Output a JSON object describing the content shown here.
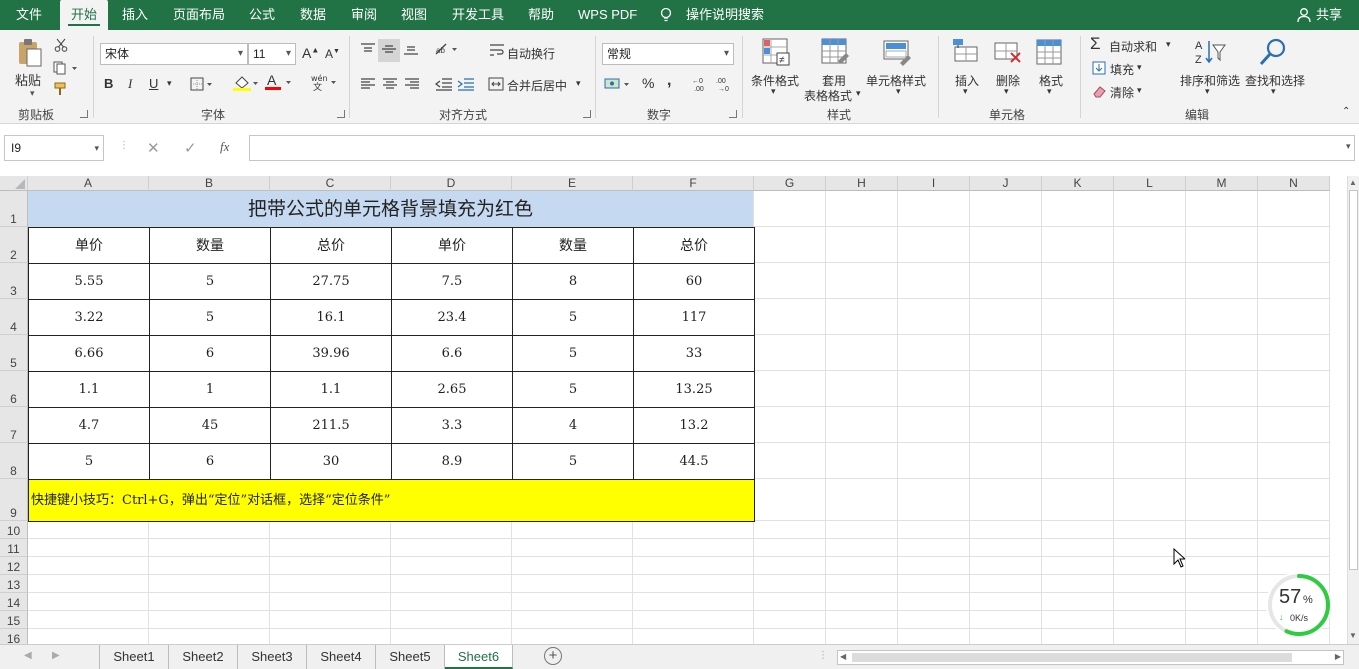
{
  "menu": {
    "file": "文件",
    "home": "开始",
    "insert": "插入",
    "layout": "页面布局",
    "formula": "公式",
    "data": "数据",
    "review": "审阅",
    "view": "视图",
    "dev": "开发工具",
    "help": "帮助",
    "wps": "WPS PDF",
    "search": "操作说明搜索",
    "share": "共享"
  },
  "ribbon": {
    "clipboard": {
      "paste": "粘贴",
      "label": "剪贴板"
    },
    "font": {
      "name": "宋体",
      "size": "11",
      "label": "字体",
      "bold": "B",
      "italic": "I",
      "underline": "U"
    },
    "align": {
      "wrap": "自动换行",
      "merge": "合并后居中",
      "label": "对齐方式"
    },
    "number": {
      "format": "常规",
      "percent": "%",
      "comma": ",",
      "label": "数字"
    },
    "styles": {
      "cond": "条件格式",
      "table_l1": "套用",
      "table_l2": "表格格式",
      "cell": "单元格样式",
      "label": "样式"
    },
    "cells": {
      "insert": "插入",
      "delete": "删除",
      "format": "格式",
      "label": "单元格"
    },
    "edit": {
      "autosum": "自动求和",
      "fill": "填充",
      "clear": "清除",
      "sort": "排序和筛选",
      "find": "查找和选择",
      "label": "编辑"
    }
  },
  "formula_bar": {
    "name_box": "I9",
    "fx": "fx",
    "value": ""
  },
  "columns": [
    "A",
    "B",
    "C",
    "D",
    "E",
    "F",
    "G",
    "H",
    "I",
    "J",
    "K",
    "L",
    "M",
    "N"
  ],
  "rows": [
    "1",
    "2",
    "3",
    "4",
    "5",
    "6",
    "7",
    "8",
    "9",
    "10",
    "11",
    "12",
    "13",
    "14",
    "15",
    "16"
  ],
  "sheet": {
    "title": "把带公式的单元格背景填充为红色",
    "headers": [
      "单价",
      "数量",
      "总价",
      "单价",
      "数量",
      "总价"
    ],
    "data": [
      [
        "5.55",
        "5",
        "27.75",
        "7.5",
        "8",
        "60"
      ],
      [
        "3.22",
        "5",
        "16.1",
        "23.4",
        "5",
        "117"
      ],
      [
        "6.66",
        "6",
        "39.96",
        "6.6",
        "5",
        "33"
      ],
      [
        "1.1",
        "1",
        "1.1",
        "2.65",
        "5",
        "13.25"
      ],
      [
        "4.7",
        "45",
        "211.5",
        "3.3",
        "4",
        "13.2"
      ],
      [
        "5",
        "6",
        "30",
        "8.9",
        "5",
        "44.5"
      ]
    ],
    "tip": "快捷键小技巧：Ctrl+G，弹出“定位”对话框，选择“定位条件”"
  },
  "tabs": [
    "Sheet1",
    "Sheet2",
    "Sheet3",
    "Sheet4",
    "Sheet5",
    "Sheet6"
  ],
  "network": {
    "percent": "57",
    "unit": "%",
    "speed": "0K/s"
  },
  "colors": {
    "accent": "#217346",
    "title_fill": "#c5d9f1",
    "tip_fill": "#ffff00"
  }
}
